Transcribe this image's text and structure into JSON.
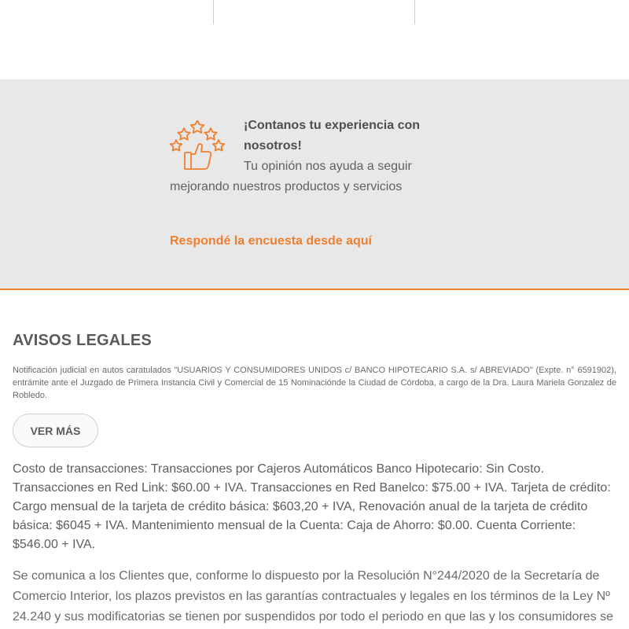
{
  "survey": {
    "icon": "thumbs-up-stars-icon",
    "title": "¡Contanos tu experiencia con nosotros!",
    "body": "Tu opinión nos ayuda a seguir mejorando nuestros productos y servicios",
    "link_label": "Respondé la encuesta desde aquí",
    "accent_color": "#f07f2d"
  },
  "legal": {
    "title": "AVISOS LEGALES",
    "notice": "Notificación judicial en autos caratulados \"USUARIOS Y CONSUMIDORES UNIDOS c/ BANCO HIPOTECARIO S.A. s/ ABREVIADO\" (Expte. n° 6591902), entrámite ante el Juzgado de Primera Instancia Civil y Comercial de 15 Nominaciónde la Ciudad de Córdoba, a cargo de la Dra. Laura Mariela Gonzalez de Robledo.",
    "more_button": "VER MÁS",
    "costs": "Costo de transacciones: Transacciones por Cajeros Automáticos Banco Hipotecario: Sin Costo. Transacciones en Red Link: $60.00 + IVA. Transacciones en Red Banelco: $75.00 + IVA. Tarjeta de crédito: Cargo mensual de la tarjeta de crédito básica: $603,20 + IVA, Renovación anual de la tarjeta de crédito básica: $6045 + IVA. Mantenimiento mensual de la Cuenta: Caja de Ahorro: $0.00. Cuenta Corriente: $546.00 + IVA.",
    "resolution": "Se comunica a los Clientes que, conforme lo dispuesto por la Resolución N°244/2020 de la Secretaría de Comercio Interior, los plazos previstos en las garantías contractuales y legales en los términos de la Ley Nº 24.240 y sus modificatorias se tienen por suspendidos por todo el periodo en que las y los consumidores se"
  }
}
